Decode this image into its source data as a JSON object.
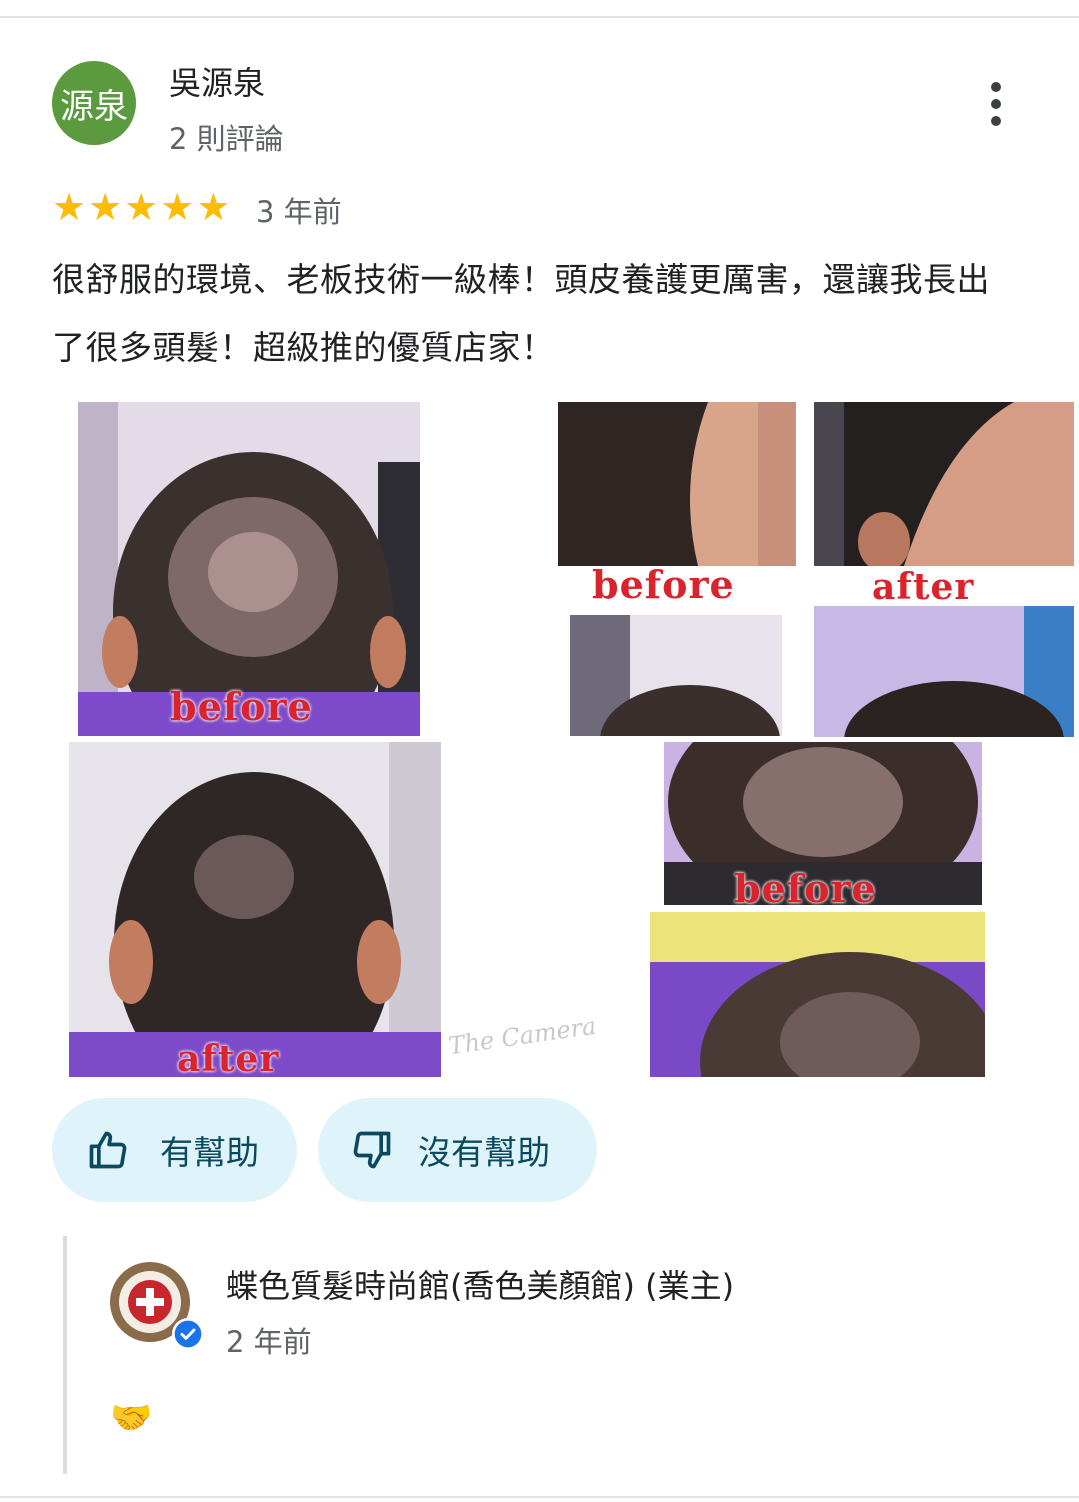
{
  "review": {
    "avatar_text": "源泉",
    "reviewer_name": "吳源泉",
    "review_count": "2 則評論",
    "time": "3 年前",
    "rating": 5,
    "stars": [
      "★",
      "★",
      "★",
      "★",
      "★"
    ],
    "text": "很舒服的環境、老板技術一級棒！頭皮養護更厲害，還讓我長出了很多頭髮！超級推的優質店家！"
  },
  "photos": {
    "label_before": "before",
    "label_after": "after",
    "watermark": "The Camera"
  },
  "actions": {
    "helpful_label": "有幫助",
    "not_helpful_label": "沒有幫助"
  },
  "owner_reply": {
    "name": "蝶色質髮時尚館(喬色美顏館) (業主)",
    "time": "2 年前",
    "text": "🤝"
  },
  "colors": {
    "star": "#fbbc04",
    "avatar_bg": "#5c9a3f",
    "pill_bg": "#dff3fa",
    "pill_text": "#0b4a5e",
    "verified": "#1a73e8",
    "label_red": "#d9232d"
  },
  "icons": {
    "more": "more-vert-icon",
    "thumb_up": "thumb-up-icon",
    "thumb_down": "thumb-down-icon",
    "verified": "verified-badge-icon"
  }
}
